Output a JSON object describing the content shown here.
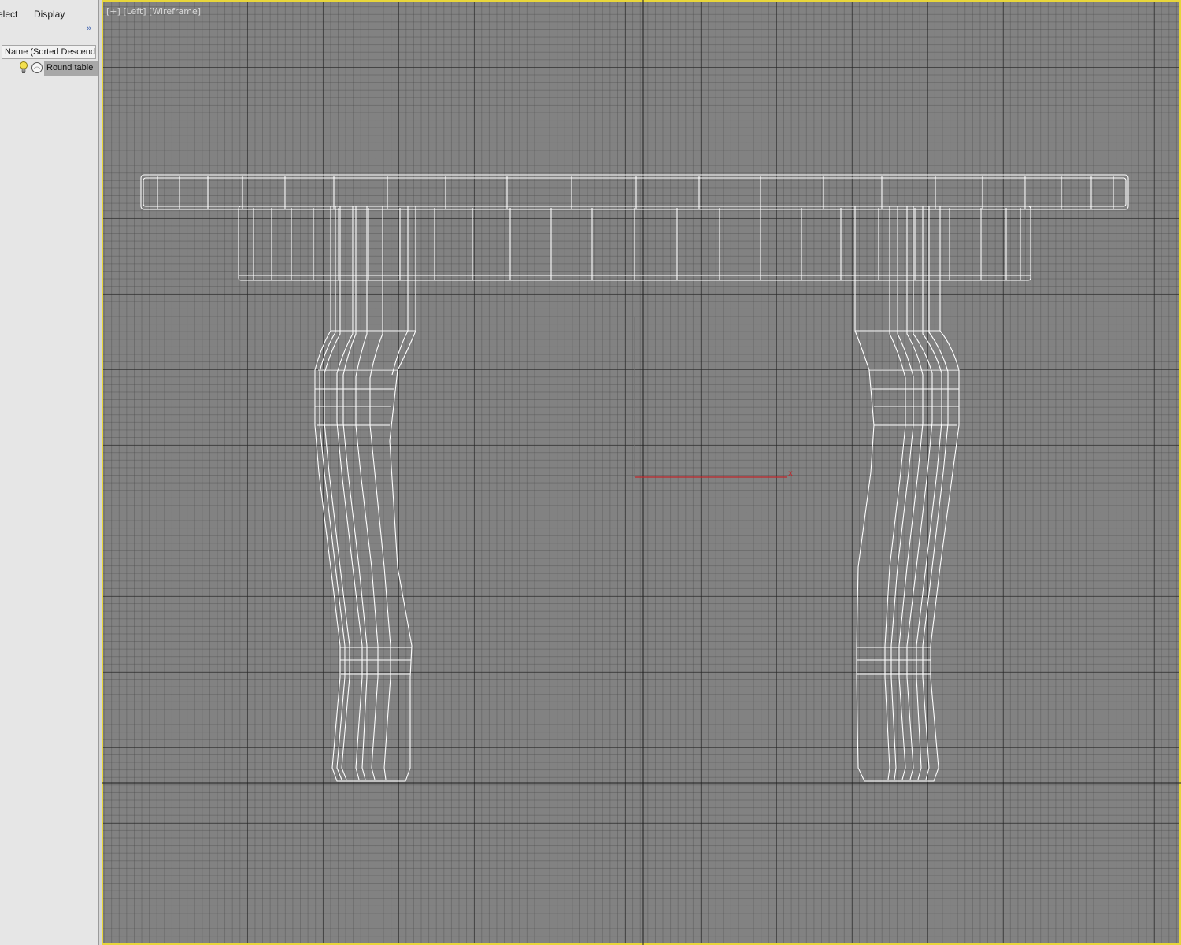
{
  "explorer": {
    "menu": {
      "select": "elect",
      "display": "Display"
    },
    "more_icon": "double-chevron-right-icon",
    "column_header": "Name (Sorted Descendin",
    "rows": [
      {
        "label": "Round table",
        "icons": [
          "lightbulb-icon",
          "teapot-render-icon"
        ]
      }
    ]
  },
  "viewport": {
    "labels": {
      "plus": "[+]",
      "view": "[Left]",
      "shading": "[Wireframe]"
    },
    "axis_label": "x",
    "colors": {
      "background": "#828282",
      "active_border": "#e8d63a",
      "wireframe": "#ffffff",
      "x_axis": "#c0262b"
    }
  }
}
